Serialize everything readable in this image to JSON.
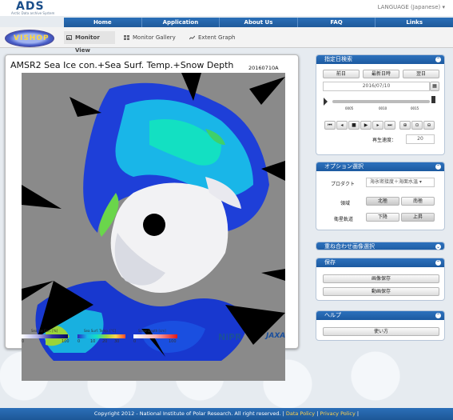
{
  "brand": {
    "logo": "ADS",
    "tagline": "Arctic Data archive System"
  },
  "language": "LANGUAGE (Japanese)",
  "nav": {
    "items": [
      "Home",
      "Application",
      "About Us",
      "FAQ",
      "Links"
    ]
  },
  "subnav": {
    "logo": "VISHOP",
    "tabs": [
      {
        "label": "Monitor View",
        "icon": "image-icon",
        "active": true
      },
      {
        "label": "Monitor Gallery",
        "icon": "grid-icon",
        "active": false
      },
      {
        "label": "Extent Graph",
        "icon": "line-chart-icon",
        "active": false
      }
    ]
  },
  "viewer": {
    "title": "AMSR2 Sea Ice con.+Sea Surf. Temp.+Snow Depth",
    "date_code": "20160710A",
    "legends": [
      {
        "label": "Sea Ice Con. [%]",
        "ticks": [
          "0",
          "100"
        ]
      },
      {
        "label": "Sea Surf. Temp. [°C]",
        "ticks": [
          "0",
          "10",
          "20",
          "30"
        ]
      },
      {
        "label": "Snow Depth [cm]",
        "ticks": [
          "0",
          "100"
        ]
      }
    ],
    "logos": {
      "nipr": "NiPR",
      "jaxa": "JAXA"
    }
  },
  "date_panel": {
    "header": "指定日検索",
    "prev": "前日",
    "latest": "最新日時",
    "next": "翌日",
    "date_value": "2016/07/10",
    "slider_ticks": [
      "0005",
      "0010",
      "0015"
    ],
    "speed_label": "再生速度：",
    "speed_value": "20"
  },
  "option_panel": {
    "header": "オプション選択",
    "product_label": "プロダクト",
    "product_value": "海氷密接度＋海面水温",
    "region_label": "領域",
    "region_options": [
      "北極",
      "南極"
    ],
    "orbit_label": "衛星軌道",
    "orbit_options": [
      "下降",
      "上昇"
    ]
  },
  "overlay_panel": {
    "header": "重ね合わせ画像選択"
  },
  "save_panel": {
    "header": "保存",
    "save_image": "画像保存",
    "save_movie": "動画保存"
  },
  "help_panel": {
    "header": "ヘルプ",
    "usage": "使い方"
  },
  "footer": {
    "copyright": "Copyright 2012 - National Institute of Polar Research. All right reserved. |",
    "data_policy": "Data Policy",
    "sep": "|",
    "privacy_policy": "Privacy Policy",
    "end": "|"
  }
}
